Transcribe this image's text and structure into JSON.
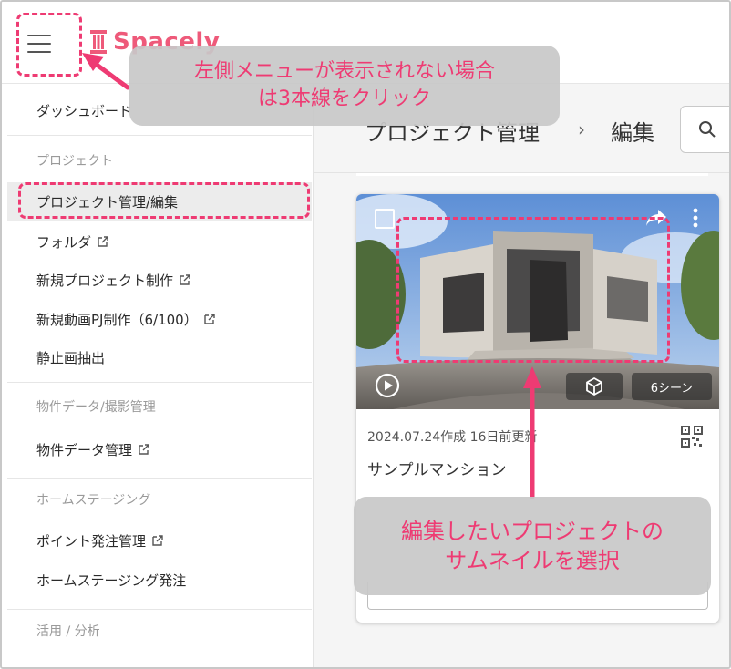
{
  "header": {
    "logo_text": "Spacely",
    "menu_icon": "hamburger-menu-icon"
  },
  "sidebar": {
    "items": [
      {
        "label": "ダッシュボード",
        "external": false
      },
      {
        "label": "プロジェクト管理/編集",
        "external": false,
        "active": true
      },
      {
        "label": "フォルダ",
        "external": true
      },
      {
        "label": "新規プロジェクト制作",
        "external": true
      },
      {
        "label": "新規動画PJ制作（6/100）",
        "external": true
      },
      {
        "label": "静止画抽出",
        "external": false
      },
      {
        "label": "物件データ管理",
        "external": true
      },
      {
        "label": "ポイント発注管理",
        "external": true
      },
      {
        "label": "ホームステージング発注",
        "external": false
      }
    ],
    "sections": [
      "プロジェクト",
      "物件データ/撮影管理",
      "ホームステージング",
      "活用 / 分析"
    ]
  },
  "breadcrumb": {
    "part1": "プロジェクト管理",
    "separator": "›",
    "part2": "編集"
  },
  "card": {
    "date": "2024.07.24作成 16日前更新",
    "name": "サンプルマンション",
    "scene_badge": "6シーン",
    "icons": [
      "checkbox-icon",
      "share-icon",
      "more-vert-icon",
      "play-icon",
      "cube-icon",
      "qr-code-icon"
    ]
  },
  "annotations": {
    "top_callout": [
      "左側メニューが表示されない場合",
      "は3本線をクリック"
    ],
    "bottom_callout": [
      "編集したいプロジェクトの",
      "サムネイルを選択"
    ],
    "accent_color": "#ee3b73"
  },
  "colors": {
    "brand": "#ee5a7a",
    "active_bg": "#ececec"
  }
}
